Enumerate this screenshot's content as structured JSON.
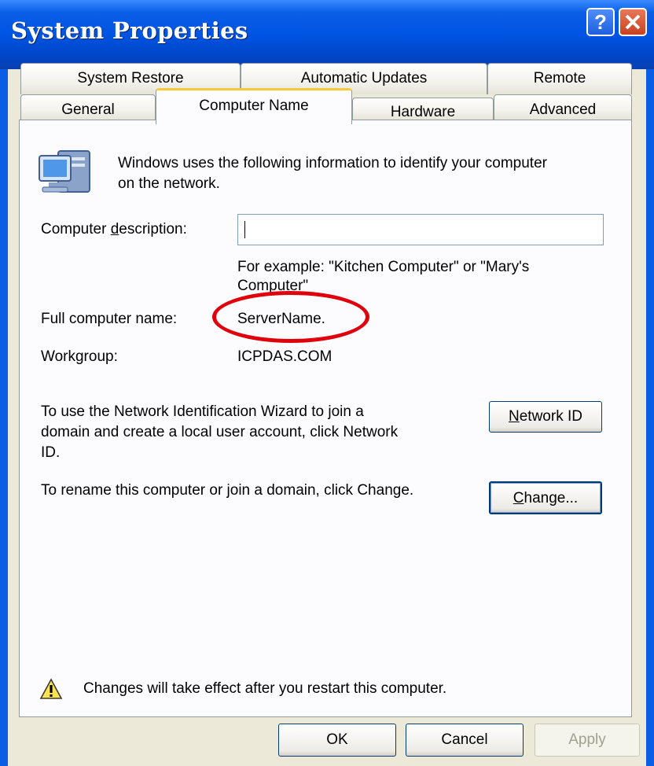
{
  "window": {
    "title": "System Properties"
  },
  "tabs_back": [
    "System Restore",
    "Automatic Updates",
    "Remote"
  ],
  "tabs_front": [
    "General",
    "Computer Name",
    "Hardware",
    "Advanced"
  ],
  "intro_line1": "Windows uses the following information to identify your computer",
  "intro_line2": "on the network.",
  "description": {
    "label_pre": "Computer ",
    "label_mnemonic": "d",
    "label_post": "escription:",
    "value": "",
    "hint_line1": "For example: \"Kitchen Computer\" or \"Mary's",
    "hint_line2": "Computer\""
  },
  "full_name": {
    "label": "Full computer name:",
    "value": "ServerName."
  },
  "workgroup": {
    "label": "Workgroup:",
    "value": "ICPDAS.COM"
  },
  "network_id": {
    "text_line1": "To use the Network Identification Wizard to join a",
    "text_line2": "domain and create a local user account, click Network",
    "text_line3": "ID.",
    "button_mnemonic": "N",
    "button_rest": "etwork ID"
  },
  "change": {
    "text": "To rename this computer or join a domain, click Change.",
    "button_mnemonic": "C",
    "button_rest": "hange..."
  },
  "warning_text": "Changes will take effect after you restart this computer.",
  "buttons": {
    "ok": "OK",
    "cancel": "Cancel",
    "apply": "Apply"
  },
  "icons": {
    "computer": "computer-icon",
    "warning": "warning-icon",
    "help": "help-icon",
    "close": "close-icon"
  },
  "colors": {
    "titlebar": "#0054E3",
    "face": "#ECE9D8",
    "highlight_circle": "#E0000B",
    "active_tab_accent": "#FFC83C"
  }
}
